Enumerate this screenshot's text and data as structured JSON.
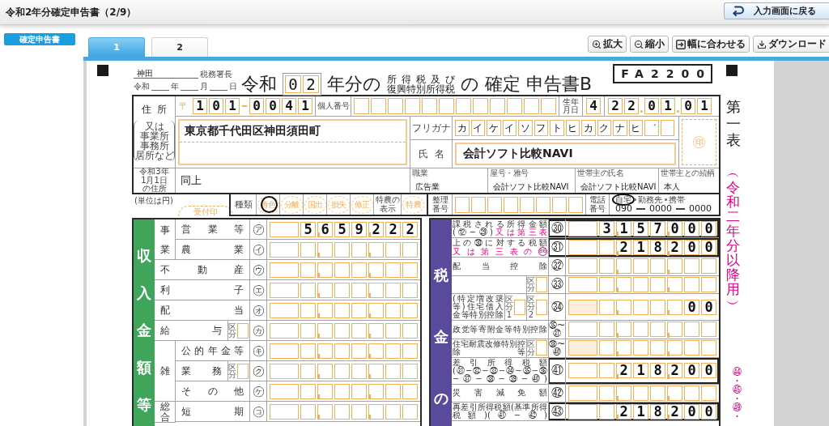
{
  "window": {
    "title": "令和2年分確定申告書（2/9）",
    "back_button": "入力画面に戻る"
  },
  "sidebar": {
    "items": [
      {
        "label": "確定申告書",
        "selected": true
      }
    ]
  },
  "tabs": [
    {
      "label": "1",
      "selected": true
    },
    {
      "label": "2",
      "selected": false
    }
  ],
  "toolbar": [
    {
      "kind": "zoom_in",
      "label": "拡大"
    },
    {
      "kind": "zoom_out",
      "label": "縮小"
    },
    {
      "kind": "fit_width",
      "label": "幅に合わせる"
    },
    {
      "kind": "download",
      "label": "ダウンロード"
    }
  ],
  "form": {
    "header": {
      "tax_office": "神田",
      "tax_office_suffix": "税務署長",
      "date_parts": [
        "令和",
        "年",
        "月",
        "日"
      ],
      "era": "令和",
      "year": "02",
      "year_suffix": "年分の",
      "tax_names": [
        "所得税及び",
        "復興特別所得税"
      ],
      "particle": "の",
      "return_type": "確定",
      "return_name": "申告書B",
      "form_code": "FA2200"
    },
    "identity": {
      "address_label": "住所",
      "address_note": [
        "又は",
        "事業所",
        "事務所",
        "居所など"
      ],
      "postal_mark": "〒",
      "postal_code": [
        "101",
        "0041"
      ],
      "my_number_label": "個人番号",
      "birth_label": "生年月日",
      "birth_era": "4",
      "birth_date": [
        "22",
        "01",
        "01"
      ],
      "address": "東京都千代田区神田須田町",
      "furigana_label": "フリガナ",
      "furigana": "カイケイソフトヒカクナヒ゛",
      "name_label": "氏名",
      "name": "会計ソフト比較NAVI",
      "seal": "印",
      "prev_address_label": "令和3年1月1日の住所",
      "prev_address": "同上",
      "details": [
        {
          "label": "職業",
          "value": "広告業"
        },
        {
          "label": "屋号・雅号",
          "value": "会計ソフト比較NAVI"
        },
        {
          "label": "世帯主の氏名",
          "value": "会計ソフト比較NAVI"
        },
        {
          "label": "世帯主との続柄",
          "value": "本人"
        }
      ]
    },
    "filing": {
      "unit_note": "(単位は円)",
      "receipt_stamp": "受付印",
      "type_label": "種類",
      "types": [
        {
          "label": "青色",
          "selected": true
        },
        {
          "label": "分離",
          "selected": false
        },
        {
          "label": "国出",
          "selected": false
        },
        {
          "label": "損失",
          "selected": false
        },
        {
          "label": "修正",
          "selected": false
        }
      ],
      "special_label": "特農の表示",
      "special": {
        "label": "特農",
        "selected": false
      },
      "ref_label": "整理番号",
      "phone_label": "電話番号",
      "phone_types": [
        {
          "label": "自宅",
          "selected": true
        },
        {
          "label": "勤務先",
          "selected": false
        },
        {
          "label": "携帯",
          "selected": false
        }
      ],
      "phone": [
        "090",
        "0000",
        "0000"
      ]
    },
    "income": {
      "title": "収入金額等",
      "groups": [
        {
          "title": "事業",
          "rows": [
            {
              "label": "営業等",
              "mark": "㋐",
              "value": "5659222"
            },
            {
              "label": "農業",
              "mark": "㋑"
            }
          ]
        },
        {
          "rows": [
            {
              "label": "不動産",
              "mark": "㋒"
            }
          ]
        },
        {
          "rows": [
            {
              "label": "利子",
              "mark": "㋓"
            }
          ]
        },
        {
          "rows": [
            {
              "label": "配当",
              "mark": "㋔"
            }
          ]
        },
        {
          "rows": [
            {
              "label": "給与",
              "category": "区分",
              "mark": "㋕"
            }
          ]
        },
        {
          "title": "雑",
          "rows": [
            {
              "label": "公的年金等",
              "mark": "㋖"
            },
            {
              "label": "業務",
              "category": "区分",
              "mark": "㋗"
            },
            {
              "label": "その他",
              "mark": "㋘"
            }
          ]
        },
        {
          "title": "総合",
          "rows": [
            {
              "label": "短期",
              "mark": "㋙"
            }
          ]
        }
      ]
    },
    "tax": {
      "title": "税金の",
      "rows": [
        {
          "kind": "framed",
          "label": "課税される所得金額",
          "formula": "(⑫−㉙)",
          "note": "又は第三表",
          "mark": "㉚",
          "value": "3157000"
        },
        {
          "kind": "framed",
          "label": "上の㉚に対する税額",
          "note": "又は第三表の",
          "note_ref": "86",
          "mark": "㉛",
          "value": "218200"
        },
        {
          "kind": "plain",
          "label": "配当控除",
          "mark": "㉜"
        },
        {
          "kind": "plain",
          "categories": [
            "区分"
          ],
          "mark": "㉝"
        },
        {
          "kind": "shaded",
          "label": "(特定増改築等)住宅借入金等特別控除",
          "categories": [
            "区分1",
            "区分2"
          ],
          "mark": "㉞",
          "value": "00"
        },
        {
          "kind": "plain",
          "label": "政党等寄附金等特別控除",
          "mark": "㉟〜㊲"
        },
        {
          "kind": "shaded",
          "label": "住宅耐震改修特別控除等",
          "categories": [
            "区分"
          ],
          "mark": "㊳〜㊵"
        },
        {
          "kind": "framed",
          "label": "差引所得税額",
          "formula": "(㉛−㉜−㉝−㉞−㉟−㊱−㊲−㊳−㊴−㊵)",
          "mark": "㊶",
          "value": "218200"
        },
        {
          "kind": "plain",
          "label": "災害減免額",
          "mark": "㊷"
        },
        {
          "kind": "framed",
          "label": "再差引所得税額(基準所得税額)",
          "formula": "(㊶−㊷)",
          "mark": "㊸",
          "value": "218200"
        }
      ]
    },
    "side": {
      "sheet": "第一表",
      "edition": "︵令和二年分以降用︶",
      "refs": "㊹・㊺・㊾・"
    }
  }
}
